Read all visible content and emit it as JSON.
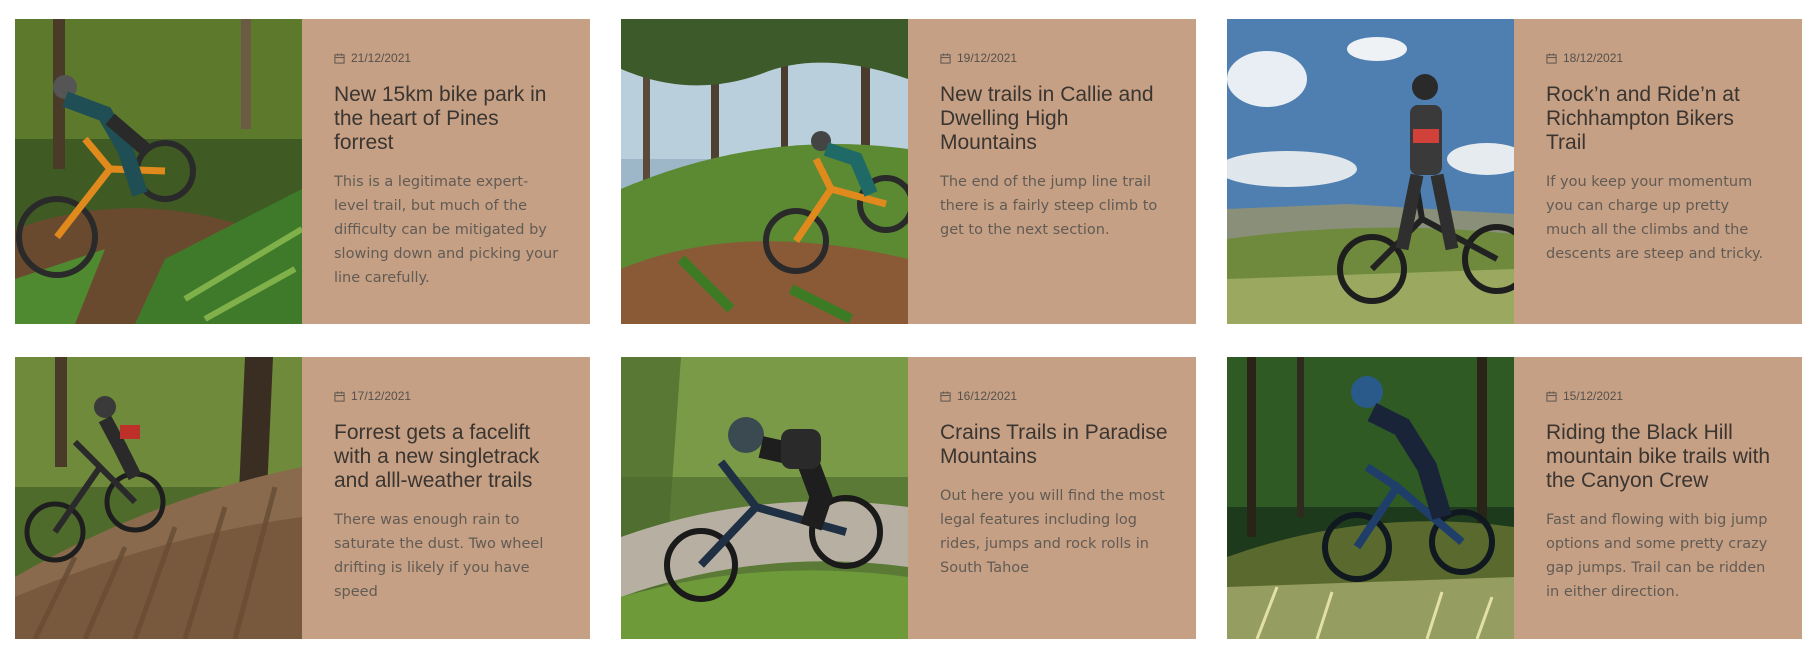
{
  "cards": [
    {
      "date": "21/12/2021",
      "title": "New 15km bike park in the heart of Pines forrest",
      "description": "This is a legitimate expert-level trail, but much of the difficulty can be mitigated by slowing down and picking your line carefully."
    },
    {
      "date": "19/12/2021",
      "title": "New trails in Callie and Dwelling High Mountains",
      "description": "The end of the jump line trail there is a fairly steep climb to get to the next section."
    },
    {
      "date": "18/12/2021",
      "title": "Rock’n and Ride’n at Richhampton Bikers Trail",
      "description": "If you keep your momentum you can charge up pretty much all the climbs and the descents are steep and tricky."
    },
    {
      "date": "17/12/2021",
      "title": "Forrest gets a facelift with a new singletrack and alll-weather trails",
      "description": "There was enough rain to saturate the dust. Two wheel drifting is likely if you have speed"
    },
    {
      "date": "16/12/2021",
      "title": "Crains Trails in Paradise Mountains",
      "description": "Out here you will find the most legal features including log rides, jumps and rock rolls in South Tahoe"
    },
    {
      "date": "15/12/2021",
      "title": "Riding the Black Hill mountain bike trails with the Canyon Crew",
      "description": "Fast and flowing with big jump options and some pretty crazy gap jumps. Trail can be ridden in either direction."
    }
  ],
  "icons": {
    "date": "calendar-icon"
  },
  "colors": {
    "card_background": "#c6a084",
    "title_text": "#3a3531",
    "body_text": "#615b55",
    "page_background": "#ffffff"
  }
}
